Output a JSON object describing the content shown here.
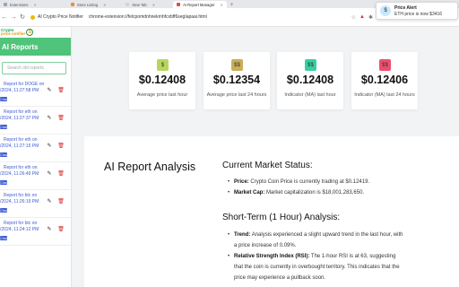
{
  "browser": {
    "tabs": [
      {
        "label": "Extensions",
        "active": false,
        "color": "#9aa4b2"
      },
      {
        "label": "Store Listing",
        "active": false,
        "color": "#f28b30"
      },
      {
        "label": "New Tab",
        "active": false,
        "color": "#cfd3d8"
      },
      {
        "label": "AI Report Manager",
        "active": true,
        "color": "#e04848"
      }
    ],
    "site_name": "AI Crypto Price Notifier",
    "url": "chrome-extension://felcpomdnhnekmhfcxbff6segIapaai.html"
  },
  "notification": {
    "title": "Price Alert",
    "body": "ETH price is now $3416"
  },
  "sidebar": {
    "brand_line1": "Crypto",
    "brand_line2": "price notifier",
    "brand_mark": "S",
    "header": "AI Reports",
    "search_placeholder": "Search old reports",
    "reports": [
      {
        "title": "Report for DOGE on",
        "date": "/2024, 11:27:58 PM",
        "badge": "Chat"
      },
      {
        "title": "Report for eth on",
        "date": "/2024, 11:27:37 PM",
        "badge": "Chat"
      },
      {
        "title": "Report for eth on",
        "date": "/2024, 11:27:15 PM",
        "badge": "Chat"
      },
      {
        "title": "Report for eth on",
        "date": "/2024, 11:26:49 PM",
        "badge": "Chat"
      },
      {
        "title": "Report for btc on",
        "date": "/2024, 11:26:19 PM",
        "badge": "Chat"
      },
      {
        "title": "Report for btc on",
        "date": "/2024, 11:24:12 PM",
        "badge": "Chat"
      }
    ]
  },
  "stats": [
    {
      "value": "$0.12408",
      "label": "Average price last hour",
      "icon": "$",
      "icon_color": "#b7d65c"
    },
    {
      "value": "$0.12354",
      "label": "Average price last 24 hours",
      "icon": "$$",
      "icon_color": "#c9ad58"
    },
    {
      "value": "$0.12408",
      "label": "Indicator (MA) last hour",
      "icon": "$$",
      "icon_color": "#36cfa0"
    },
    {
      "value": "$0.12406",
      "label": "Indicator (MA) last 24 hours",
      "icon": "$$",
      "icon_color": "#ef4d6e"
    }
  ],
  "report": {
    "title": "AI Report Analysis",
    "section1_heading": "Current Market Status:",
    "price_label": "Price:",
    "price_text": "Crypto Coin Price is currently trading at $0.12419.",
    "cap_label": "Market Cap:",
    "cap_text": "Market capitalization is $18,001,283,650.",
    "section2_heading": "Short-Term (1 Hour) Analysis:",
    "trend_label": "Trend:",
    "trend_text": "Analysis experienced a slight upward trend in the last hour, with a price increase of 0.09%.",
    "rsi_label": "Relative Strength Index (RSI):",
    "rsi_text": "The 1-hour RSI is at 63, suggesting that the coin is currently in overbought territory. This indicates that the price may experience a pullback soon."
  }
}
